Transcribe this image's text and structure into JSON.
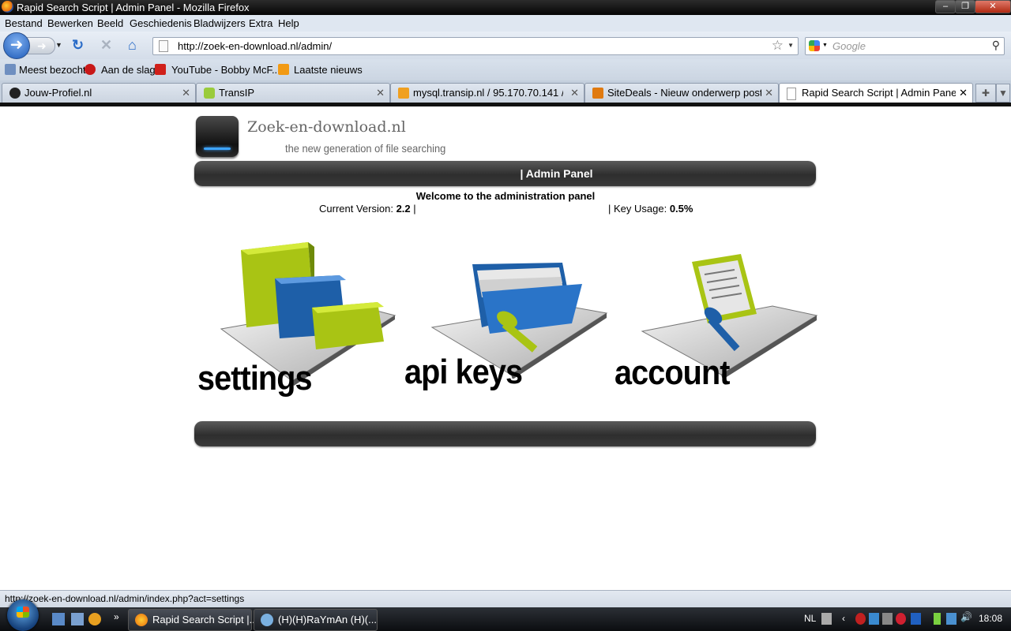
{
  "window": {
    "title": "Rapid Search Script | Admin Panel - Mozilla Firefox"
  },
  "menu": [
    "Bestand",
    "Bewerken",
    "Beeld",
    "Geschiedenis",
    "Bladwijzers",
    "Extra",
    "Help"
  ],
  "nav": {
    "url": "http://zoek-en-download.nl/admin/",
    "search_placeholder": "Google"
  },
  "bookmarks": [
    "Meest bezocht",
    "Aan de slag",
    "YouTube - Bobby McF...",
    "Laatste nieuws"
  ],
  "tabs": [
    {
      "label": "Jouw-Profiel.nl",
      "active": false
    },
    {
      "label": "TransIP",
      "active": false
    },
    {
      "label": "mysql.transip.nl / 95.170.70.141 / j...",
      "active": false
    },
    {
      "label": "SiteDeals - Nieuw onderwerp posten",
      "active": false
    },
    {
      "label": "Rapid Search Script | Admin Panel",
      "active": true
    }
  ],
  "page": {
    "logo_title": "Zoek-en-download.nl",
    "logo_subtitle": "the new generation of file searching",
    "header_bar": "| Admin Panel",
    "welcome": "Welcome to the administration panel",
    "version_label": "Current Version:",
    "version_value": "2.2",
    "version_sep": "|",
    "key_label": "| Key Usage:",
    "key_value": "0.5%",
    "tiles": [
      {
        "label": "settings",
        "icon": "settings-chart-icon"
      },
      {
        "label": "api keys",
        "icon": "folder-key-icon"
      },
      {
        "label": "account",
        "icon": "document-pen-icon"
      }
    ]
  },
  "status": {
    "text": "http://zoek-en-download.nl/admin/index.php?act=settings"
  },
  "taskbar": {
    "tasks": [
      "Rapid Search Script |...",
      "(H)(H)RaYmAn (H)(..."
    ],
    "language": "NL",
    "time": "18:08"
  },
  "colors": {
    "accent": "#1d5ab8",
    "panel_bar": "#3a3a3a",
    "lime": "#a9c414",
    "blue": "#1e5fa8"
  }
}
